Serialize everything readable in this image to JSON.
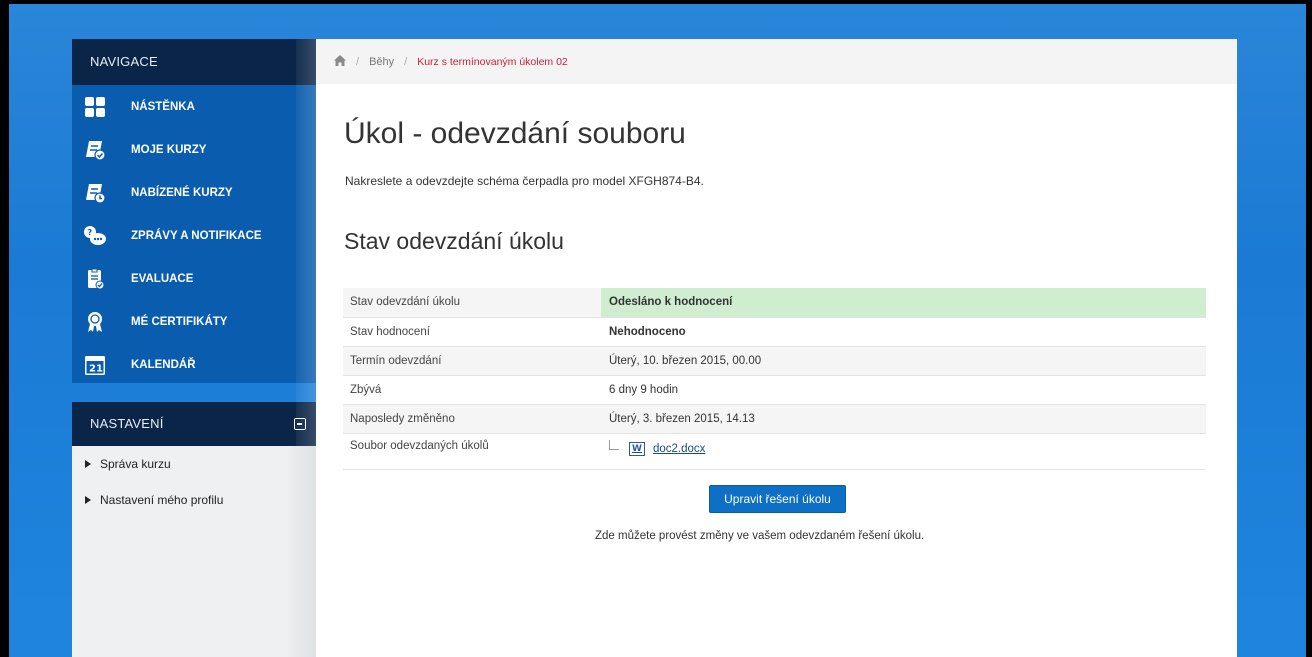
{
  "sidebar": {
    "nav_title": "NAVIGACE",
    "nav_items": [
      {
        "label": "NÁSTĚNKA",
        "icon": "dashboard-icon"
      },
      {
        "label": "MOJE KURZY",
        "icon": "my-courses-icon"
      },
      {
        "label": "NABÍZENÉ KURZY",
        "icon": "offered-courses-icon"
      },
      {
        "label": "ZPRÁVY A NOTIFIKACE",
        "icon": "messages-icon"
      },
      {
        "label": "EVALUACE",
        "icon": "evaluation-icon"
      },
      {
        "label": "MÉ CERTIFIKÁTY",
        "icon": "certificate-icon"
      },
      {
        "label": "KALENDÁŘ",
        "icon": "calendar-icon",
        "badge": "21"
      }
    ],
    "settings_title": "NASTAVENÍ",
    "settings_items": [
      {
        "label": "Správa kurzu"
      },
      {
        "label": "Nastavení mého profilu"
      }
    ]
  },
  "breadcrumb": {
    "home_icon": "home-icon",
    "items": [
      "Běhy",
      "Kurz s termínovaným úkolem 02"
    ]
  },
  "main": {
    "title": "Úkol - odevzdání souboru",
    "description": "Nakreslete a odevzdejte schéma čerpadla pro model XFGH874-B4.",
    "section_title": "Stav odevzdání úkolu",
    "status_rows": [
      {
        "label": "Stav odevzdání úkolu",
        "value": "Odesláno k hodnocení"
      },
      {
        "label": "Stav hodnocení",
        "value": "Nehodnoceno"
      },
      {
        "label": "Termín odevzdání",
        "value": "Úterý, 10. březen 2015, 00.00"
      },
      {
        "label": "Zbývá",
        "value": "6 dny 9 hodin"
      },
      {
        "label": "Naposledy změněno",
        "value": "Úterý, 3. březen 2015, 14.13"
      },
      {
        "label": "Soubor odevzdaných úkolů",
        "file": "doc2.docx"
      }
    ],
    "edit_button": "Upravit řešení úkolu",
    "help_text": "Zde můžete provést změny ve vašem odevzdaném řešení úkolu."
  },
  "colors": {
    "sidebar_header": "#0a2547",
    "sidebar_nav": "#0a5cae",
    "submitted_bg": "#cfeed0",
    "breadcrumb_current": "#c6203a",
    "button": "#0d6fc5"
  }
}
